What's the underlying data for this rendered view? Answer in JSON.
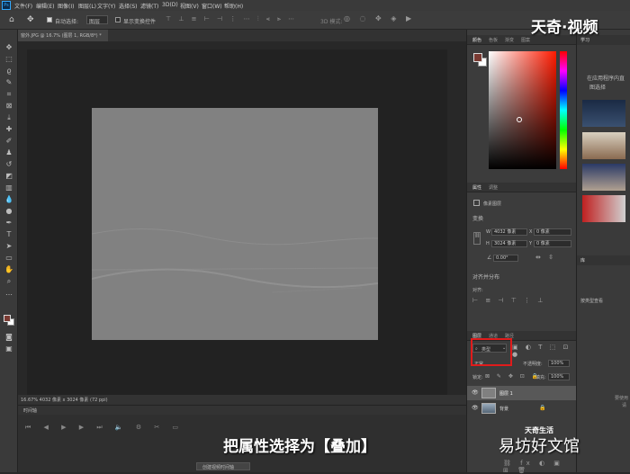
{
  "menubar": {
    "ps_logo": "Ps",
    "items": [
      "文件(F)",
      "编辑(E)",
      "图像(I)",
      "图层(L)",
      "文字(Y)",
      "选择(S)",
      "滤镜(T)",
      "3D(D)",
      "视图(V)",
      "窗口(W)",
      "帮助(H)"
    ]
  },
  "options": {
    "auto_select_label": "自动选择:",
    "auto_select_value": "图层",
    "show_transform_label": "显示变换控件",
    "mode_3d_label": "3D 模式:"
  },
  "document": {
    "tab_title": "窗外.JPG @ 16.7% (图层 1, RGB/8*) *",
    "status": "16.67%    4032 像素 x 3024 像素 (72 ppi)"
  },
  "timeline": {
    "title": "时间轴",
    "create_button": "创建视频时间轴"
  },
  "color_panel": {
    "tabs": [
      "颜色",
      "色板",
      "渐变",
      "图案"
    ],
    "fg_color": "#7a3a32",
    "bg_color": "#ffffff"
  },
  "properties_panel": {
    "tabs": [
      "属性",
      "调整"
    ],
    "type_label": "像素图层",
    "transform_label": "变换",
    "w_label": "W",
    "w_value": "4032 像素",
    "h_label": "H",
    "h_value": "3024 像素",
    "x_label": "X",
    "x_value": "0 像素",
    "y_label": "Y",
    "y_value": "0 像素",
    "angle_value": "0.00°",
    "align_label": "对齐并分布",
    "align_sub": "对齐:"
  },
  "layers_panel": {
    "tabs": [
      "图层",
      "通道",
      "路径"
    ],
    "filter_value": "类型",
    "blend_mode": "正常",
    "opacity_label": "不透明度:",
    "opacity_value": "100%",
    "lock_label": "锁定:",
    "fill_label": "填充:",
    "fill_value": "100%",
    "layers": [
      {
        "name": "图层 1",
        "selected": true
      },
      {
        "name": "背景",
        "selected": false
      }
    ]
  },
  "learn_panel": {
    "tab": "学习",
    "text_line1": "在应用程序内直",
    "text_line2": "图选择",
    "lib_tab": "库",
    "lib_search": "按类型查看",
    "lib_text_line1": "要使用",
    "lib_text_line2": "请"
  },
  "overlay": {
    "subtitle": "把属性选择为【叠加】",
    "logo": "天奇·视频",
    "watermark_small": "天奇生活",
    "watermark": "易坊好文馆"
  },
  "highlight_color": "#e01b1b"
}
